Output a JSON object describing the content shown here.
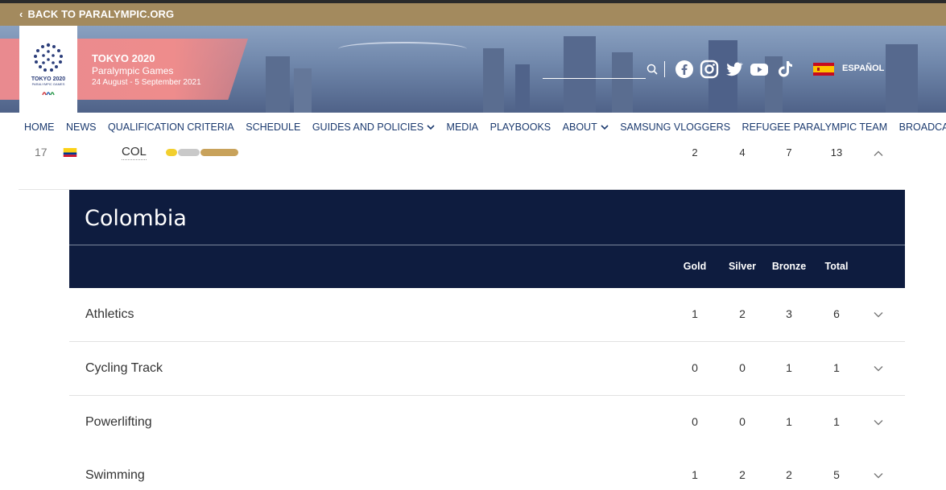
{
  "topbar": {
    "back_label": "BACK TO PARALYMPIC.ORG"
  },
  "header": {
    "logo_text": "TOKYO 2020",
    "logo_subtext": "PARALYMPIC GAMES",
    "event_title": "TOKYO 2020",
    "event_subtitle": "Paralympic Games",
    "event_dates": "24 August - 5 September 2021",
    "language_label": "ESPAÑOL",
    "search": {
      "placeholder": ""
    },
    "social_icons": [
      "facebook-icon",
      "instagram-icon",
      "twitter-icon",
      "youtube-icon",
      "tiktok-icon"
    ]
  },
  "nav": {
    "items": [
      {
        "label": "HOME",
        "dropdown": false
      },
      {
        "label": "NEWS",
        "dropdown": false
      },
      {
        "label": "QUALIFICATION CRITERIA",
        "dropdown": false
      },
      {
        "label": "SCHEDULE",
        "dropdown": false
      },
      {
        "label": "GUIDES AND POLICIES",
        "dropdown": true
      },
      {
        "label": "MEDIA",
        "dropdown": false
      },
      {
        "label": "PLAYBOOKS",
        "dropdown": false
      },
      {
        "label": "ABOUT",
        "dropdown": true
      },
      {
        "label": "SAMSUNG VLOGGERS",
        "dropdown": false
      },
      {
        "label": "REFUGEE PARALYMPIC TEAM",
        "dropdown": false
      },
      {
        "label": "BROADCAST",
        "dropdown": false
      }
    ]
  },
  "country_row": {
    "rank": "17",
    "code": "COL",
    "gold": "2",
    "silver": "4",
    "bronze": "7",
    "total": "13",
    "medal_share": {
      "gold": 2,
      "silver": 4,
      "bronze": 7
    }
  },
  "panel": {
    "country_name": "Colombia",
    "headers": {
      "gold": "Gold",
      "silver": "Silver",
      "bronze": "Bronze",
      "total": "Total"
    }
  },
  "sports": [
    {
      "name": "Athletics",
      "gold": "1",
      "silver": "2",
      "bronze": "3",
      "total": "6"
    },
    {
      "name": "Cycling Track",
      "gold": "0",
      "silver": "0",
      "bronze": "1",
      "total": "1"
    },
    {
      "name": "Powerlifting",
      "gold": "0",
      "silver": "0",
      "bronze": "1",
      "total": "1"
    },
    {
      "name": "Swimming",
      "gold": "1",
      "silver": "2",
      "bronze": "2",
      "total": "5"
    }
  ],
  "colors": {
    "topbar": "#a38a5e",
    "nav_text": "#1b3a6f",
    "panel_bg": "#0e1c3f",
    "gold_pill": "#f2cf2e",
    "silver_pill": "#c9c9c9",
    "bronze_pill": "#c8a25b"
  }
}
